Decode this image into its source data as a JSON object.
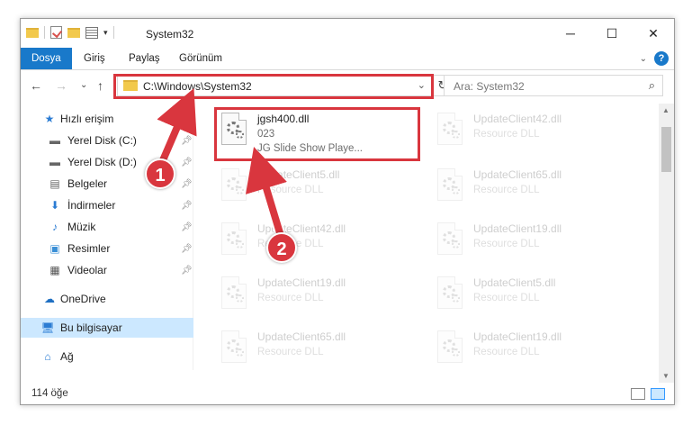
{
  "window": {
    "title": "System32"
  },
  "ribbon": {
    "tabs": [
      "Dosya",
      "Giriş",
      "Paylaş",
      "Görünüm"
    ]
  },
  "address": {
    "path": "C:\\Windows\\System32"
  },
  "search": {
    "placeholder": "Ara: System32"
  },
  "sidebar": {
    "items": [
      {
        "label": "Hızlı erişim"
      },
      {
        "label": "Yerel Disk (C:)"
      },
      {
        "label": "Yerel Disk (D:)"
      },
      {
        "label": "Belgeler"
      },
      {
        "label": "İndirmeler"
      },
      {
        "label": "Müzik"
      },
      {
        "label": "Resimler"
      },
      {
        "label": "Videolar"
      },
      {
        "label": "OneDrive"
      },
      {
        "label": "Bu bilgisayar"
      },
      {
        "label": "Ağ"
      }
    ]
  },
  "files": {
    "highlighted": {
      "name": "jgsh400.dll",
      "line2": "023",
      "line3": "JG Slide Show Playe..."
    },
    "others": [
      {
        "name": "UpdateClient42.dll",
        "type": "Resource DLL"
      },
      {
        "name": "UpdateClient5.dll",
        "type": "Resource DLL"
      },
      {
        "name": "UpdateClient65.dll",
        "type": "Resource DLL"
      },
      {
        "name": "UpdateClient42.dll",
        "type": "Resource DLL"
      },
      {
        "name": "UpdateClient19.dll",
        "type": "Resource DLL"
      },
      {
        "name": "UpdateClient19.dll",
        "type": "Resource DLL"
      },
      {
        "name": "UpdateClient5.dll",
        "type": "Resource DLL"
      },
      {
        "name": "UpdateClient65.dll",
        "type": "Resource DLL"
      },
      {
        "name": "UpdateClient19.dll",
        "type": "Resource DLL"
      }
    ]
  },
  "status": {
    "count": "114 öğe"
  },
  "callouts": {
    "one": "1",
    "two": "2"
  }
}
